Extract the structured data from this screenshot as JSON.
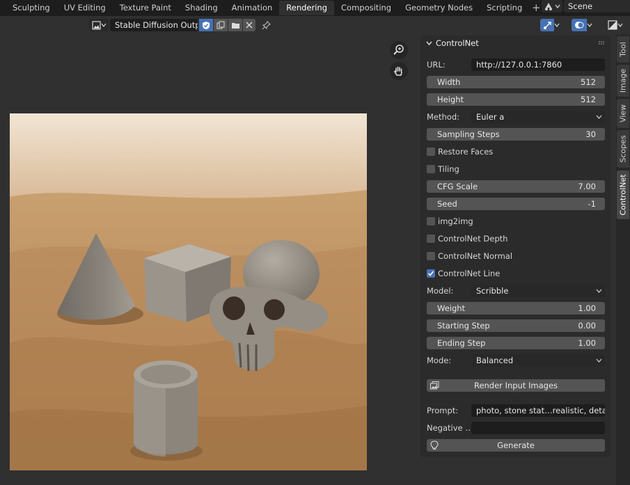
{
  "workspaces": {
    "tabs": [
      "Sculpting",
      "UV Editing",
      "Texture Paint",
      "Shading",
      "Animation",
      "Rendering",
      "Compositing",
      "Geometry Nodes",
      "Scripting"
    ],
    "active": "Rendering",
    "add_label": "+"
  },
  "scene": {
    "name": "Scene"
  },
  "image_editor": {
    "image_name": "Stable Diffusion Output"
  },
  "tabs_right": [
    "Tool",
    "Image",
    "View",
    "Scopes",
    "ControlNet"
  ],
  "panel": {
    "title": "ControlNet",
    "url_label": "URL:",
    "url_value": "http://127.0.0.1:7860",
    "width_label": "Width",
    "width_value": "512",
    "height_label": "Height",
    "height_value": "512",
    "method_label": "Method:",
    "method_value": "Euler a",
    "steps_label": "Sampling Steps",
    "steps_value": "30",
    "restore_faces_label": "Restore Faces",
    "tiling_label": "Tiling",
    "cfg_label": "CFG Scale",
    "cfg_value": "7.00",
    "seed_label": "Seed",
    "seed_value": "-1",
    "img2img_label": "img2img",
    "cn_depth_label": "ControlNet Depth",
    "cn_normal_label": "ControlNet Normal",
    "cn_line_label": "ControlNet Line",
    "model_label": "Model:",
    "model_value": "Scribble",
    "weight_label": "Weight",
    "weight_value": "1.00",
    "start_label": "Starting Step",
    "start_value": "0.00",
    "end_label": "Ending Step",
    "end_value": "1.00",
    "mode_label": "Mode:",
    "mode_value": "Balanced",
    "render_inputs_label": "Render Input Images",
    "prompt_label": "Prompt:",
    "prompt_value": "photo, stone stat…realistic, detailed",
    "negative_label": "Negative …",
    "negative_value": "",
    "generate_label": "Generate",
    "checks": {
      "restore_faces": false,
      "tiling": false,
      "img2img": false,
      "cn_depth": false,
      "cn_normal": false,
      "cn_line": true
    }
  },
  "colors": {
    "accent": "#4772b3",
    "bg": "#303030",
    "panel": "#2b2b2b",
    "slider": "#545454",
    "field": "#1d1d1d"
  }
}
